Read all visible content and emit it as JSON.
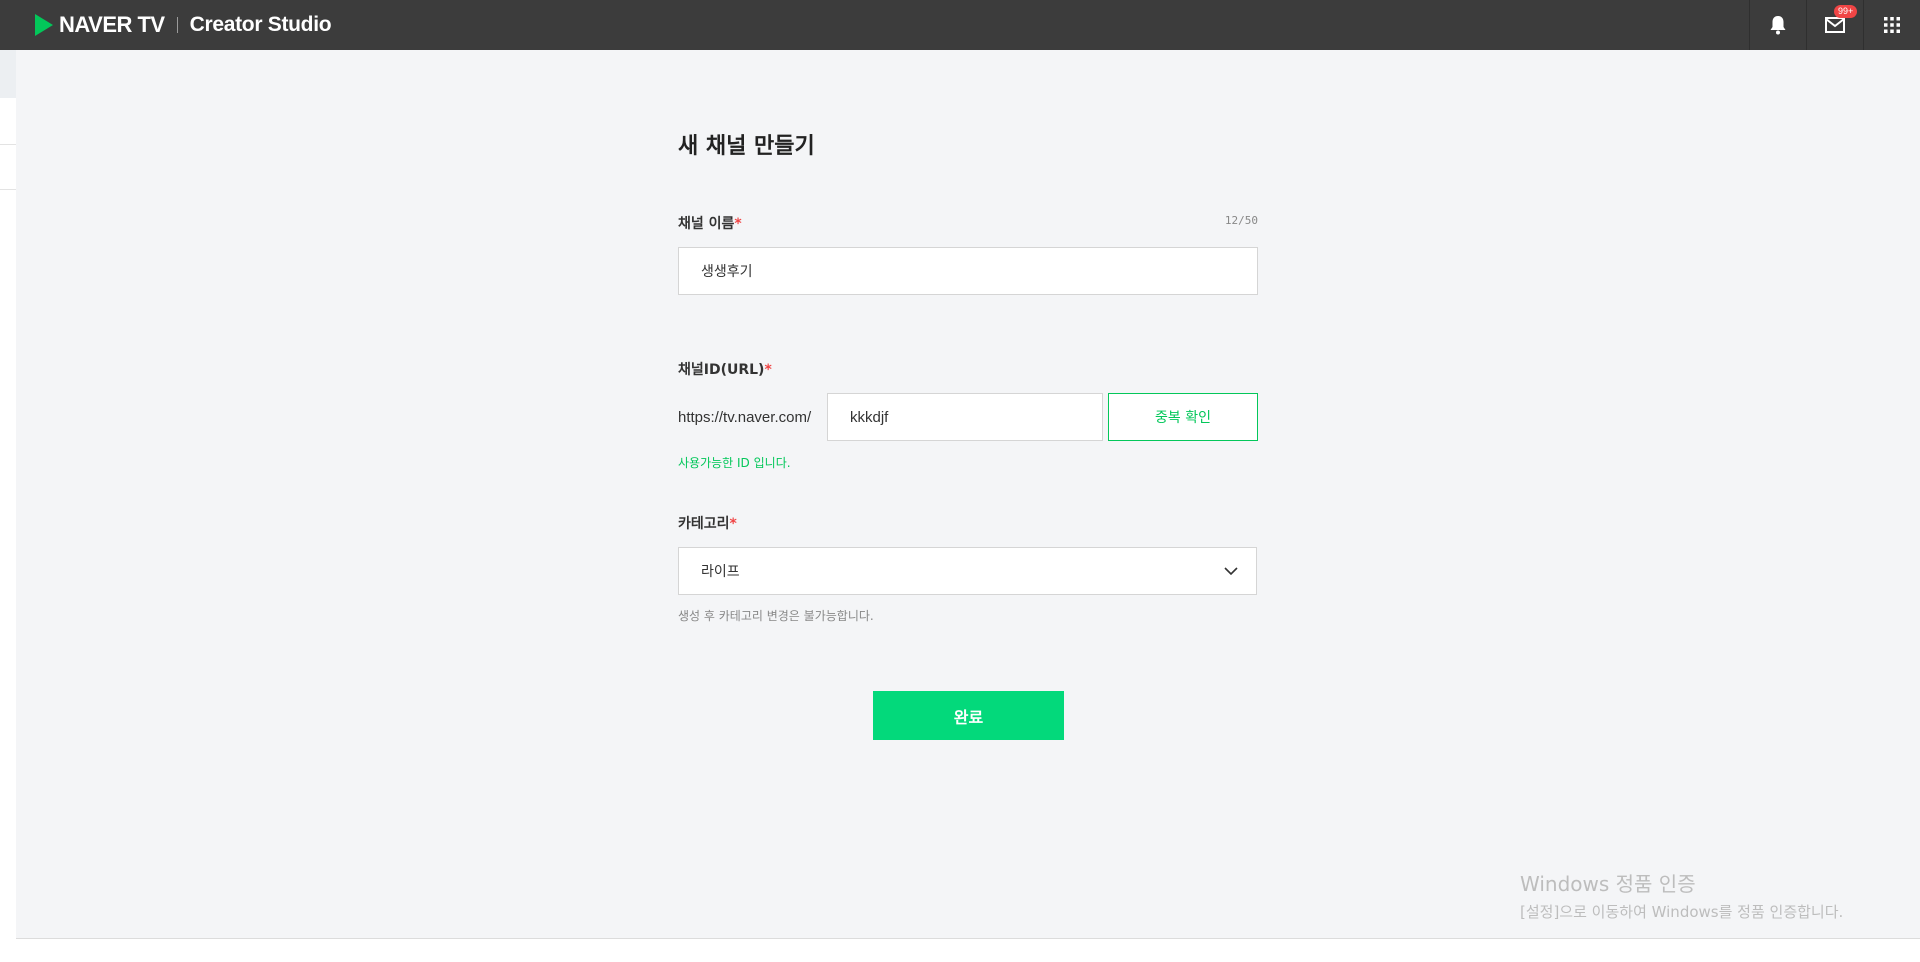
{
  "header": {
    "brand": "NAVER TV",
    "studio": "Creator Studio",
    "mail_badge": "99+",
    "icons": [
      "bell-icon",
      "mail-icon",
      "apps-grid-icon"
    ]
  },
  "form": {
    "title": "새 채널 만들기",
    "channel_name": {
      "label": "채널 이름",
      "required_mark": "*",
      "value": "생생후기",
      "counter": "12/50"
    },
    "channel_id": {
      "label": "채널ID(URL)",
      "required_mark": "*",
      "prefix": "https://tv.naver.com/",
      "value": "kkkdjf",
      "check_button": "중복 확인",
      "status": "사용가능한 ID 입니다."
    },
    "category": {
      "label": "카테고리",
      "required_mark": "*",
      "selected": "라이프",
      "help": "생성 후 카테고리 변경은 불가능합니다."
    },
    "submit_label": "완료"
  },
  "watermark": {
    "line1": "Windows 정품 인증",
    "line2": "[설정]으로 이동하여 Windows를 정품 인증합니다."
  },
  "colors": {
    "topbar": "#3c3c3c",
    "accent": "#03c75a",
    "submit": "#03d97b",
    "required": "#f04545",
    "background": "#f4f5f7"
  }
}
